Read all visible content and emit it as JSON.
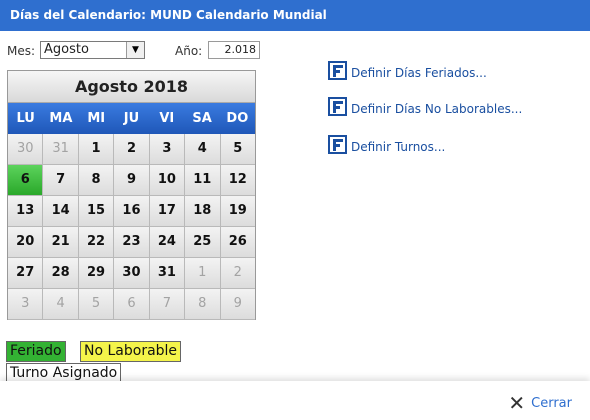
{
  "window": {
    "title": "Días del Calendario: MUND Calendario Mundial"
  },
  "filters": {
    "month_label": "Mes:",
    "month_value": "Agosto",
    "year_label": "Año:",
    "year_value": "2.018"
  },
  "calendar": {
    "header": "Agosto  2018",
    "days_of_week": [
      "LU",
      "MA",
      "MI",
      "JU",
      "VI",
      "SA",
      "DO"
    ],
    "weeks": [
      [
        {
          "d": "30",
          "other": true
        },
        {
          "d": "31",
          "other": true
        },
        {
          "d": "1"
        },
        {
          "d": "2"
        },
        {
          "d": "3"
        },
        {
          "d": "4"
        },
        {
          "d": "5"
        }
      ],
      [
        {
          "d": "6",
          "holiday": true
        },
        {
          "d": "7"
        },
        {
          "d": "8"
        },
        {
          "d": "9"
        },
        {
          "d": "10"
        },
        {
          "d": "11"
        },
        {
          "d": "12"
        }
      ],
      [
        {
          "d": "13"
        },
        {
          "d": "14"
        },
        {
          "d": "15"
        },
        {
          "d": "16"
        },
        {
          "d": "17"
        },
        {
          "d": "18"
        },
        {
          "d": "19"
        }
      ],
      [
        {
          "d": "20"
        },
        {
          "d": "21"
        },
        {
          "d": "22"
        },
        {
          "d": "23"
        },
        {
          "d": "24"
        },
        {
          "d": "25"
        },
        {
          "d": "26"
        }
      ],
      [
        {
          "d": "27"
        },
        {
          "d": "28"
        },
        {
          "d": "29"
        },
        {
          "d": "30"
        },
        {
          "d": "31"
        },
        {
          "d": "1",
          "other": true
        },
        {
          "d": "2",
          "other": true
        }
      ],
      [
        {
          "d": "3",
          "other": true
        },
        {
          "d": "4",
          "other": true
        },
        {
          "d": "5",
          "other": true
        },
        {
          "d": "6",
          "other": true
        },
        {
          "d": "7",
          "other": true
        },
        {
          "d": "8",
          "other": true
        },
        {
          "d": "9",
          "other": true
        }
      ]
    ]
  },
  "links": [
    {
      "label": "Definir Días Feriados...",
      "icon": "define-form-icon"
    },
    {
      "label": "Definir Días No Laborables...",
      "icon": "define-form-icon"
    },
    {
      "label": "Definir Turnos...",
      "icon": "define-form-icon"
    }
  ],
  "legend": {
    "feriado": "Feriado",
    "no_laborable": "No Laborable",
    "turno": "Turno Asignado"
  },
  "footer": {
    "close_label": "Cerrar",
    "close_icon": "close-icon"
  },
  "colors": {
    "titlebar": "#2f6fcf",
    "holiday": "#33b233",
    "non_working": "#f4f44a",
    "link": "#1a4fa0"
  }
}
